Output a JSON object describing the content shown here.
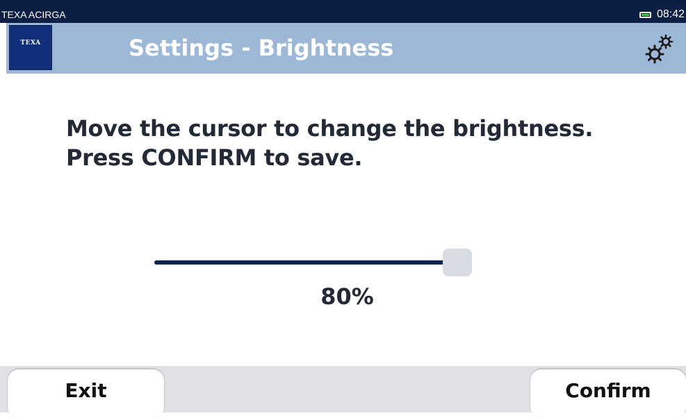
{
  "status_bar": {
    "app_name": "TEXA ACIRGA",
    "time": "08:42",
    "battery_icon": "battery-icon",
    "battery_color": "#33d43a"
  },
  "header": {
    "logo_text": "TEXA",
    "title": "Settings - Brightness",
    "settings_icon": "gears-icon",
    "background_color": "#9db7d6"
  },
  "instructions": {
    "line1": "Move the cursor to change the brightness.",
    "line2": "Press CONFIRM to save."
  },
  "brightness": {
    "level": 0.8,
    "label": "80%"
  },
  "buttons": {
    "exit_label": "Exit",
    "confirm_label": "Confirm"
  },
  "colors": {
    "status_bar": "#0b1f45",
    "slider_track": "#0b2451",
    "slider_thumb": "#d7dbe2"
  }
}
